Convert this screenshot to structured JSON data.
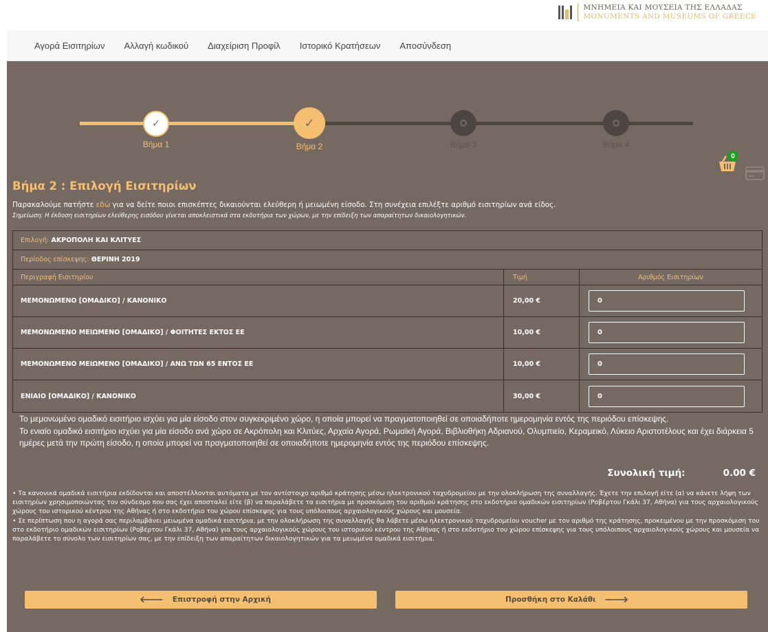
{
  "logo": {
    "gr": "ΜΝΗΜΕΙΑ ΚΑΙ ΜΟΥΣΕΙΑ ΤΗΣ ΕΛΛΑΔΑΣ",
    "en": "MONUMENTS AND MUSEUMS OF GREECE"
  },
  "nav": [
    "Αγορά Εισιτηρίων",
    "Αλλαγή κωδικού",
    "Διαχείριση Προφίλ",
    "Ιστορικό Κρατήσεων",
    "Αποσύνδεση"
  ],
  "steps": [
    {
      "label": "Βήμα 1",
      "state": "done"
    },
    {
      "label": "Βήμα 2",
      "state": "current"
    },
    {
      "label": "Βήμα 3",
      "state": "pending"
    },
    {
      "label": "Βήμα 4",
      "state": "pending"
    }
  ],
  "cart": {
    "count": "0"
  },
  "heading": "Βήμα 2 : Επιλογή Εισιτηρίων",
  "intro": {
    "before": "Παρακαλούμε πατήστε ",
    "link": "εδώ",
    "after": " για να δείτε ποιοι επισκέπτες δικαιούνται ελεύθερη ή μειωμένη είσοδο. Στη συνέχεια επιλέξτε αριθμό εισιτηρίων ανά είδος.",
    "note": "Σημείωση: Η έκδοση εισιτηρίων ελεύθερης εισόδου γίνεται αποκλειστικά στα εκδοτήρια των χώρων, με την επίδειξη των απαραίτητων δικαιολογητικών."
  },
  "table": {
    "selection_label": "Επιλογή:",
    "selection_value": "ΑΚΡΟΠΟΛΗ ΚΑΙ ΚΛΙΤΥΕΣ",
    "period_label": "Περίοδος επίσκεψης:",
    "period_value": "ΘΕΡΙΝΗ 2019",
    "headers": {
      "desc": "Περιγραφή Εισιτηρίου",
      "price": "Τιμή",
      "qty": "Αριθμός Εισιτηρίων"
    },
    "rows": [
      {
        "desc": "ΜΕΜΟΝΩΜΕΝΟ [ΟΜΑΔΙΚΟ] / ΚΑΝΟΝΙΚΟ",
        "price": "20,00 €",
        "qty": "0"
      },
      {
        "desc": "ΜΕΜΟΝΩΜΕΝΟ ΜΕΙΩΜΕΝΟ [ΟΜΑΔΙΚΟ] / ΦΟΙΤΗΤΕΣ ΕΚΤΟΣ ΕΕ",
        "price": "10,00 €",
        "qty": "0"
      },
      {
        "desc": "ΜΕΜΟΝΩΜΕΝΟ ΜΕΙΩΜΕΝΟ [ΟΜΑΔΙΚΟ] / ΑΝΩ ΤΩΝ 65 ΕΝΤΟΣ ΕΕ",
        "price": "10,00 €",
        "qty": "0"
      },
      {
        "desc": "ΕΝΙΑΙΟ [ΟΜΑΔΙΚΟ] / ΚΑΝΟΝΙΚΟ",
        "price": "30,00 €",
        "qty": "0"
      }
    ]
  },
  "description": [
    "Το μεμονωμένο ομαδικό εισιτήριο ισχύει για μία είσοδο στον συγκεκριμένο χώρο, η οποία μπορεί να πραγματοποιηθεί σε οποιαδήποτε ημερομηνία εντός της περιόδου επίσκεψης.",
    "Το ενιαίο ομαδικό εισιτήριο ισχύει για μία είσοδο ανά χώρο σε Ακρόπολη και Κλιτύες, Αρχαία Αγορά, Ρωμαϊκή Αγορά, Βιβλιοθήκη Αδριανού, Ολυμπιείο, Κεραμεικό, Λύκειο Αριστοτέλους και έχει διάρκεια 5 ημέρες μετά την πρώτη είσοδο, η οποία μπορεί να πραγματοποιηθεί σε οποιαδήποτε ημερομηνία εντός της περιόδου επίσκεψης."
  ],
  "total": {
    "label": "Συνολική τιμή:",
    "value": "0.00 €"
  },
  "bullets": [
    "• Τα κανονικά ομαδικά εισιτήρια εκδίδονται και αποστέλλονται αυτόματα με τον αντίστοιχο αριθμό κράτησης μέσω ηλεκτρονικού ταχυδρομείου με την ολοκλήρωση της συναλλαγής. Έχετε την επιλογή είτε (α) να κάνετε λήψη των εισιτηρίων χρησιμοποιώντας τον σύνδεσμο που σας έχει αποσταλεί είτε (β) να παραλάβετε τα εισιτήρια με προσκόμιση του αριθμού κράτησης στο εκδοτήριο ομαδικών εισιτηρίων (Ροβέρτου Γκάλι 37, Αθήνα) για τους αρχαιολογικούς χώρους του ιστορικού κέντρου της Αθήνας ή στο εκδοτήριο του χώρου επίσκεψης για τους υπόλοιπους αρχαιολογικούς χώρους και μουσεία.",
    "• Σε περίπτωση που η αγορά σας περιλαμβάνει μειωμένα ομαδικά εισιτήρια, με την ολοκλήρωση της συναλλαγής θα λάβετε μέσω ηλεκτρονικού ταχυδρομείου voucher με τον αριθμό της κράτησης, προκειμένου με την προσκόμιση του στο εκδοτήριο ομαδικών εισιτηρίων (Ροβέρτου Γκάλι 37, Αθήνα) για τους αρχαιολογικούς χώρους του ιστορικού κέντρου της Αθήνας ή στο εκδοτήριο του χώρου επίσκεψης για τους υπόλοιπους αρχαιολογικούς χώρους και μουσεία να παραλάβετε το σύνολο των εισιτηρίων σας, με την επίδειξη των απαραίτητων δικαιολογητικών για τα μειωμένα ομαδικά εισιτήρια."
  ],
  "buttons": {
    "back": "Επιστροφή στην Αρχική",
    "add": "Προσθήκη στο Καλάθι"
  },
  "colors": {
    "accent": "#f5bf72",
    "background": "#756961",
    "line_done": "#f5bf72",
    "line_pending": "#4d4640",
    "badge": "#1ea01e"
  }
}
